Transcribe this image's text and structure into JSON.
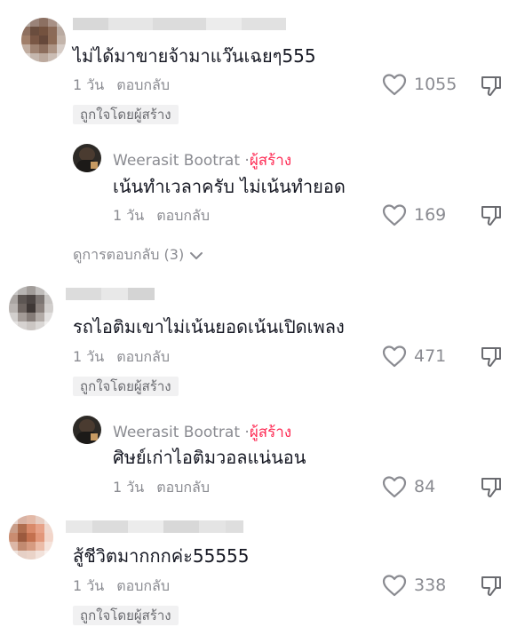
{
  "comments": [
    {
      "text": "ไม่ได้มาขายจ้ามาแว๊นเฉยๆ555",
      "time": "1 วัน",
      "reply": "ตอบกลับ",
      "likes": "1055",
      "badge": "ถูกใจโดยผู้สร้าง",
      "creator_reply": {
        "name": "Weerasit Bootrat",
        "sep": "·",
        "tag": "ผู้สร้าง",
        "text": "เน้นทำเวลาครับ ไม่เน้นทำยอด",
        "time": "1 วัน",
        "reply": "ตอบกลับ",
        "likes": "169"
      },
      "more_replies": "ดูการตอบกลับ (3)"
    },
    {
      "text": "รถไอติมเขาไม่เน้นยอดเน้นเปิดเพลง",
      "time": "1 วัน",
      "reply": "ตอบกลับ",
      "likes": "471",
      "badge": "ถูกใจโดยผู้สร้าง",
      "creator_reply": {
        "name": "Weerasit Bootrat",
        "sep": "·",
        "tag": "ผู้สร้าง",
        "text": "ศิษย์เก่าไอติมวอลแน่นอน",
        "time": "1 วัน",
        "reply": "ตอบกลับ",
        "likes": "84"
      }
    },
    {
      "text": "สู้ชีวิตมากกกค่ะ55555",
      "time": "1 วัน",
      "reply": "ตอบกลับ",
      "likes": "338",
      "badge": "ถูกใจโดยผู้สร้าง"
    }
  ],
  "icons": {
    "like": "heart-outline-icon",
    "dislike": "thumbs-down-outline-icon",
    "expand": "chevron-down-icon"
  },
  "colors": {
    "creator_tag": "#fe2c55",
    "secondary_text": "#8a8b91",
    "badge_bg": "#f1f1f2"
  }
}
